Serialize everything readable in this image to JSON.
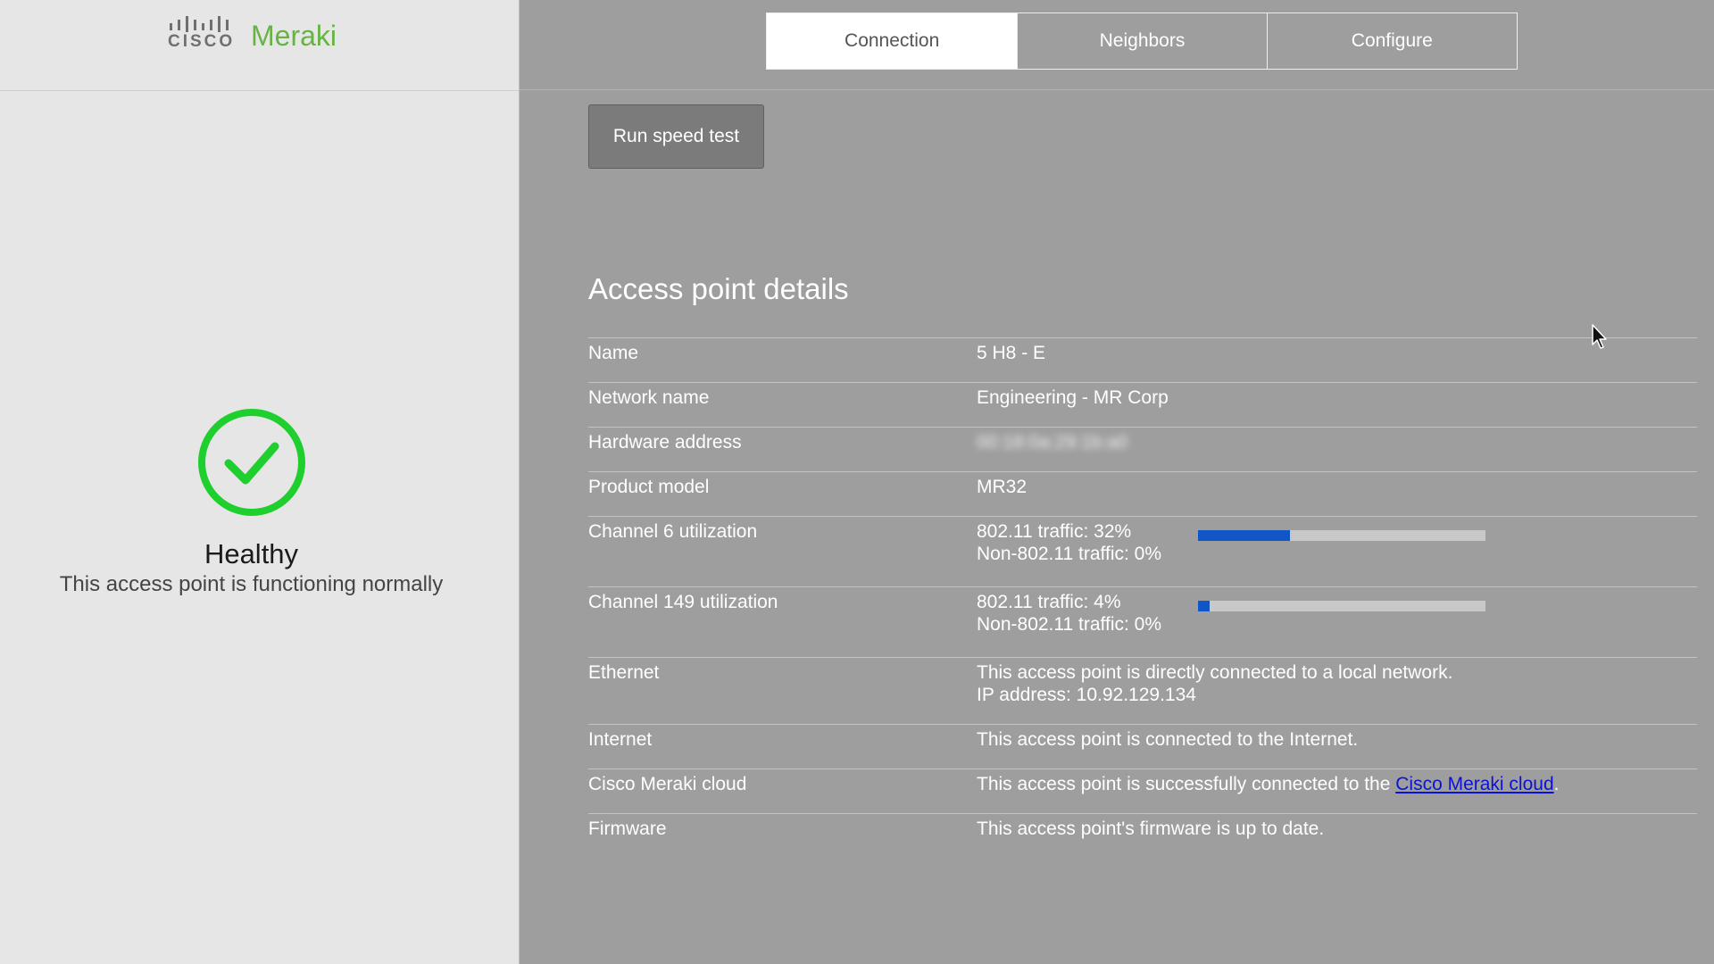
{
  "brand": {
    "cisco": "CISCO",
    "meraki": "Meraki",
    "meraki_color": "#67b346"
  },
  "status": {
    "icon": "check-circle-icon",
    "title": "Healthy",
    "description": "This access point is functioning normally",
    "color": "#1ecf2e"
  },
  "tabs": [
    {
      "label": "Connection",
      "active": true
    },
    {
      "label": "Neighbors",
      "active": false
    },
    {
      "label": "Configure",
      "active": false
    }
  ],
  "actions": {
    "speed_test": "Run speed test"
  },
  "details": {
    "title": "Access point details",
    "name": {
      "label": "Name",
      "value": "5 H8 - E"
    },
    "network": {
      "label": "Network name",
      "value": "Engineering - MR Corp"
    },
    "hardware": {
      "label": "Hardware address",
      "value": "00:18:0a:29:1b:a0"
    },
    "model": {
      "label": "Product model",
      "value": "MR32"
    },
    "channel6": {
      "label": "Channel 6 utilization",
      "wifi": "802.11 traffic: 32%",
      "non_wifi": "Non-802.11 traffic: 0%",
      "wifi_fraction": 0.32
    },
    "channel149": {
      "label": "Channel 149 utilization",
      "wifi": "802.11 traffic: 4%",
      "non_wifi": "Non-802.11 traffic: 0%",
      "wifi_fraction": 0.04
    },
    "ethernet": {
      "label": "Ethernet",
      "line1": "This access point is directly connected to a local network.",
      "line2": "IP address: 10.92.129.134"
    },
    "internet": {
      "label": "Internet",
      "value": "This access point is connected to the Internet."
    },
    "cloud": {
      "label": "Cisco Meraki cloud",
      "prefix": "This access point is successfully connected to the ",
      "link": "Cisco Meraki cloud",
      "suffix": "."
    },
    "firmware": {
      "label": "Firmware",
      "value": "This access point's firmware is up to date."
    }
  },
  "colors": {
    "bar_fill": "#1255c7",
    "link": "#0a12d6"
  }
}
